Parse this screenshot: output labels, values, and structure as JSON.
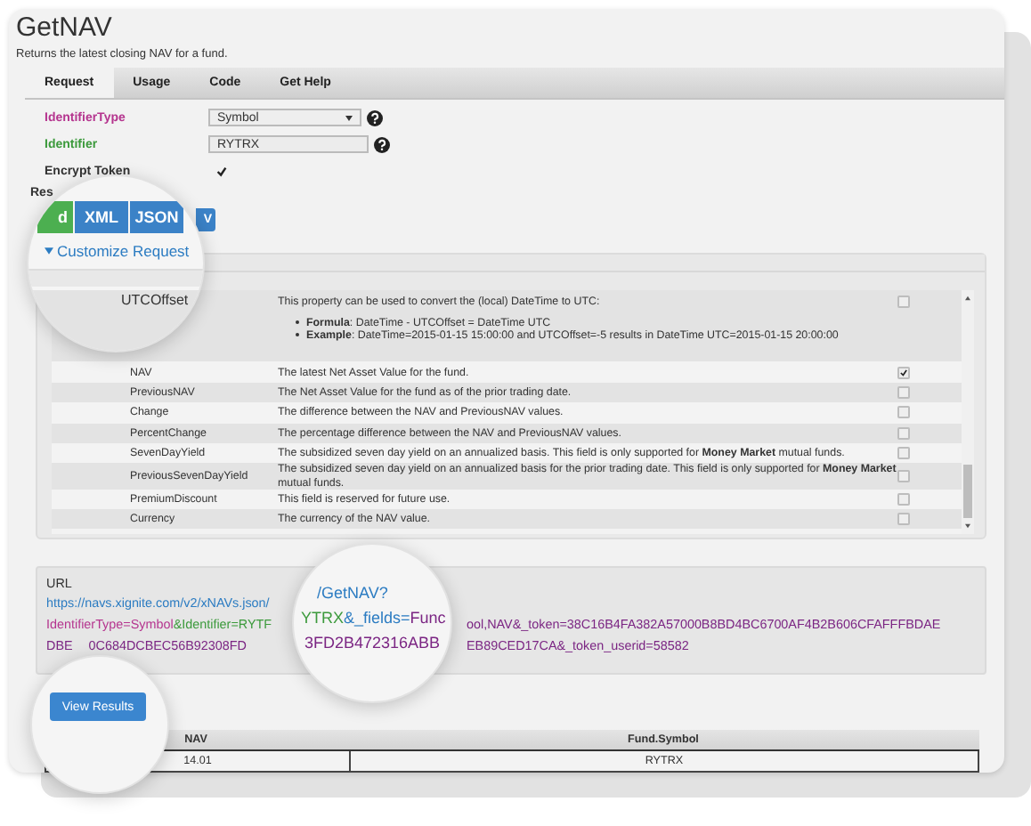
{
  "title": "GetNAV",
  "subtitle": "Returns the latest closing NAV for a fund.",
  "tabs": [
    {
      "label": "Request",
      "selected": true
    },
    {
      "label": "Usage",
      "selected": false
    },
    {
      "label": "Code",
      "selected": false
    },
    {
      "label": "Get Help",
      "selected": false
    }
  ],
  "form": [
    {
      "kind": "select",
      "label": "IdentifierType",
      "color": "#b5358f",
      "value": "Symbol"
    },
    {
      "kind": "input",
      "label": "Identifier",
      "color": "#3c9a3c",
      "value": "RYTRX"
    }
  ],
  "encrypt_token": {
    "label": "Encrypt Token",
    "checked": true
  },
  "response_label": "Res",
  "format_button": {
    "label": "V",
    "selected": false
  },
  "magnifier_top": {
    "format_buttons": [
      {
        "label": "d",
        "selected": true
      },
      {
        "label": "XML",
        "selected": false
      },
      {
        "label": "JSON",
        "selected": false
      }
    ],
    "customize_link": "Customize Request",
    "field": "UTCOffset"
  },
  "fields": [
    {
      "description": "This property can be used to convert the (local) DateTime to UTC:",
      "bullets": [
        "**Formula**: DateTime - UTCOffset = DateTime UTC",
        "**Example**: DateTime=2015-01-15 15:00:00 and UTCOffset=-5 results in DateTime UTC=2015-01-15 20:00:00"
      ],
      "checked": false
    },
    {
      "name": "NAV",
      "description": "The latest Net Asset Value for the fund.",
      "checked": true
    },
    {
      "name": "PreviousNAV",
      "description": "The Net Asset Value for the fund as of the prior trading date.",
      "checked": false
    },
    {
      "name": "Change",
      "description": "The difference between the NAV and PreviousNAV values.",
      "checked": false
    },
    {
      "name": "PercentChange",
      "description": "The percentage difference between the NAV and PreviousNAV values.",
      "checked": false
    },
    {
      "name": "SevenDayYield",
      "description": "The subsidized seven day yield on an annualized basis. This field is only supported for **Money Market** mutual funds.",
      "checked": false
    },
    {
      "name": "PreviousSevenDayYield",
      "description": "The subsidized seven day yield on an annualized basis for the prior trading date. This field is only supported for **Money Market** mutual funds.",
      "checked": false
    },
    {
      "name": "PremiumDiscount",
      "description": "This field is reserved for future use.",
      "checked": false
    },
    {
      "name": "Currency",
      "description": "The currency of the NAV value.",
      "checked": false
    }
  ],
  "url": {
    "label": "URL",
    "lines": [
      {
        "left": [
          {
            "kind": "base",
            "text": "https://navs.xignite.com/v2/xNAVs.json/"
          }
        ]
      },
      {
        "left": [
          {
            "kind": "type",
            "text": "IdentifierType=Symbol"
          },
          {
            "kind": "identifier",
            "text": "&Identifier=RYTF"
          }
        ],
        "right": [
          {
            "kind": "value",
            "text": "ool,NAV&_token=38C16B4FA382A57000B8BD4BC6700AF4B2B606CFAFFFBDAE"
          }
        ]
      },
      {
        "left": [
          {
            "kind": "value",
            "text": "DBE"
          },
          {
            "kind": "value",
            "text": "0C684DCBEC56B92308FD"
          }
        ],
        "right": [
          {
            "kind": "value",
            "text": "EB89CED17CA&_token_userid=58582"
          }
        ]
      }
    ]
  },
  "magnifier_url": [
    [
      {
        "kind": "base",
        "text": "/GetNAV?"
      }
    ],
    [
      {
        "kind": "identifier",
        "text": "YTRX"
      },
      {
        "kind": "base",
        "text": "&_fields="
      },
      {
        "kind": "value",
        "text": "Func"
      }
    ],
    [
      {
        "kind": "value",
        "text": "3FD2B472316ABB"
      }
    ]
  ],
  "magnifier_bottom": {
    "button": "View Results"
  },
  "results": {
    "columns": [
      "NAV",
      "Fund.Symbol"
    ],
    "rows": [
      [
        "14.01",
        "RYTRX"
      ]
    ]
  }
}
